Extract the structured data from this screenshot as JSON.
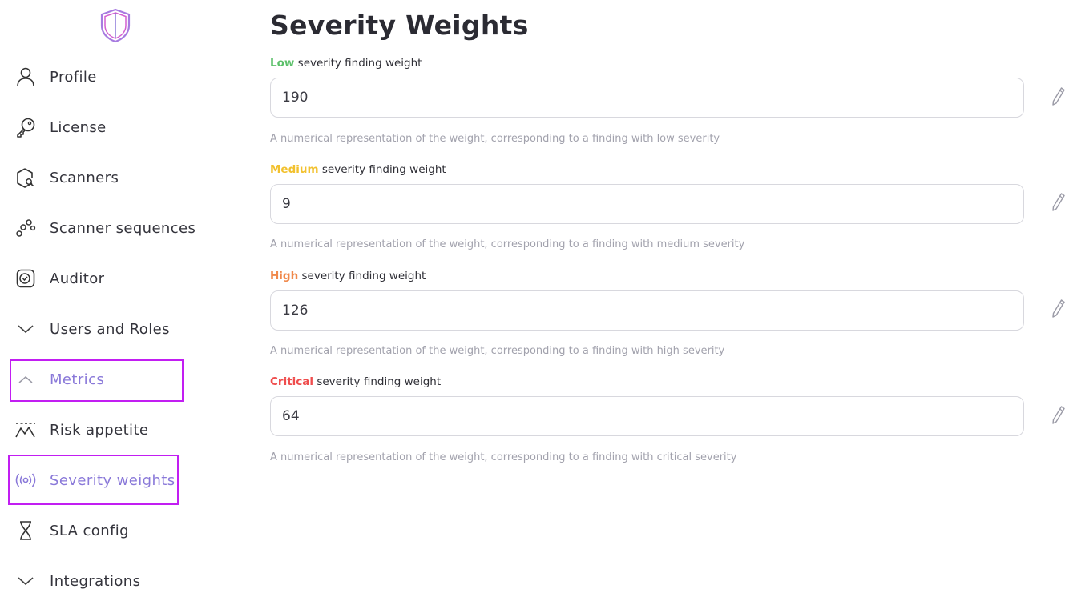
{
  "sidebar": {
    "items": [
      {
        "label": "Profile",
        "icon": "user-icon"
      },
      {
        "label": "License",
        "icon": "key-icon"
      },
      {
        "label": "Scanners",
        "icon": "scanner-icon"
      },
      {
        "label": "Scanner sequences",
        "icon": "sequence-icon"
      },
      {
        "label": "Auditor",
        "icon": "auditor-icon"
      },
      {
        "label": "Users and Roles",
        "icon": "chevron-down-icon"
      },
      {
        "label": "Metrics",
        "icon": "chevron-up-icon"
      },
      {
        "label": "Risk appetite",
        "icon": "risk-appetite-icon"
      },
      {
        "label": "Severity weights",
        "icon": "radio-waves-icon"
      },
      {
        "label": "SLA config",
        "icon": "hourglass-icon"
      },
      {
        "label": "Integrations",
        "icon": "chevron-down-icon"
      }
    ]
  },
  "main": {
    "title": "Severity Weights",
    "suffix": "severity finding weight",
    "fields": [
      {
        "severity": "Low",
        "color": "#5cc06a",
        "value": "190",
        "helper": "A numerical representation of the weight, corresponding to a finding with low severity"
      },
      {
        "severity": "Medium",
        "color": "#f2c12e",
        "value": "9",
        "helper": "A numerical representation of the weight, corresponding to a finding with medium severity"
      },
      {
        "severity": "High",
        "color": "#f0884a",
        "value": "126",
        "helper": "A numerical representation of the weight, corresponding to a finding with high severity"
      },
      {
        "severity": "Critical",
        "color": "#ef4d4d",
        "value": "64",
        "helper": "A numerical representation of the weight, corresponding to a finding with critical severity"
      }
    ]
  },
  "colors": {
    "accent": "#8a79d9",
    "highlight": "#c21ef2"
  }
}
